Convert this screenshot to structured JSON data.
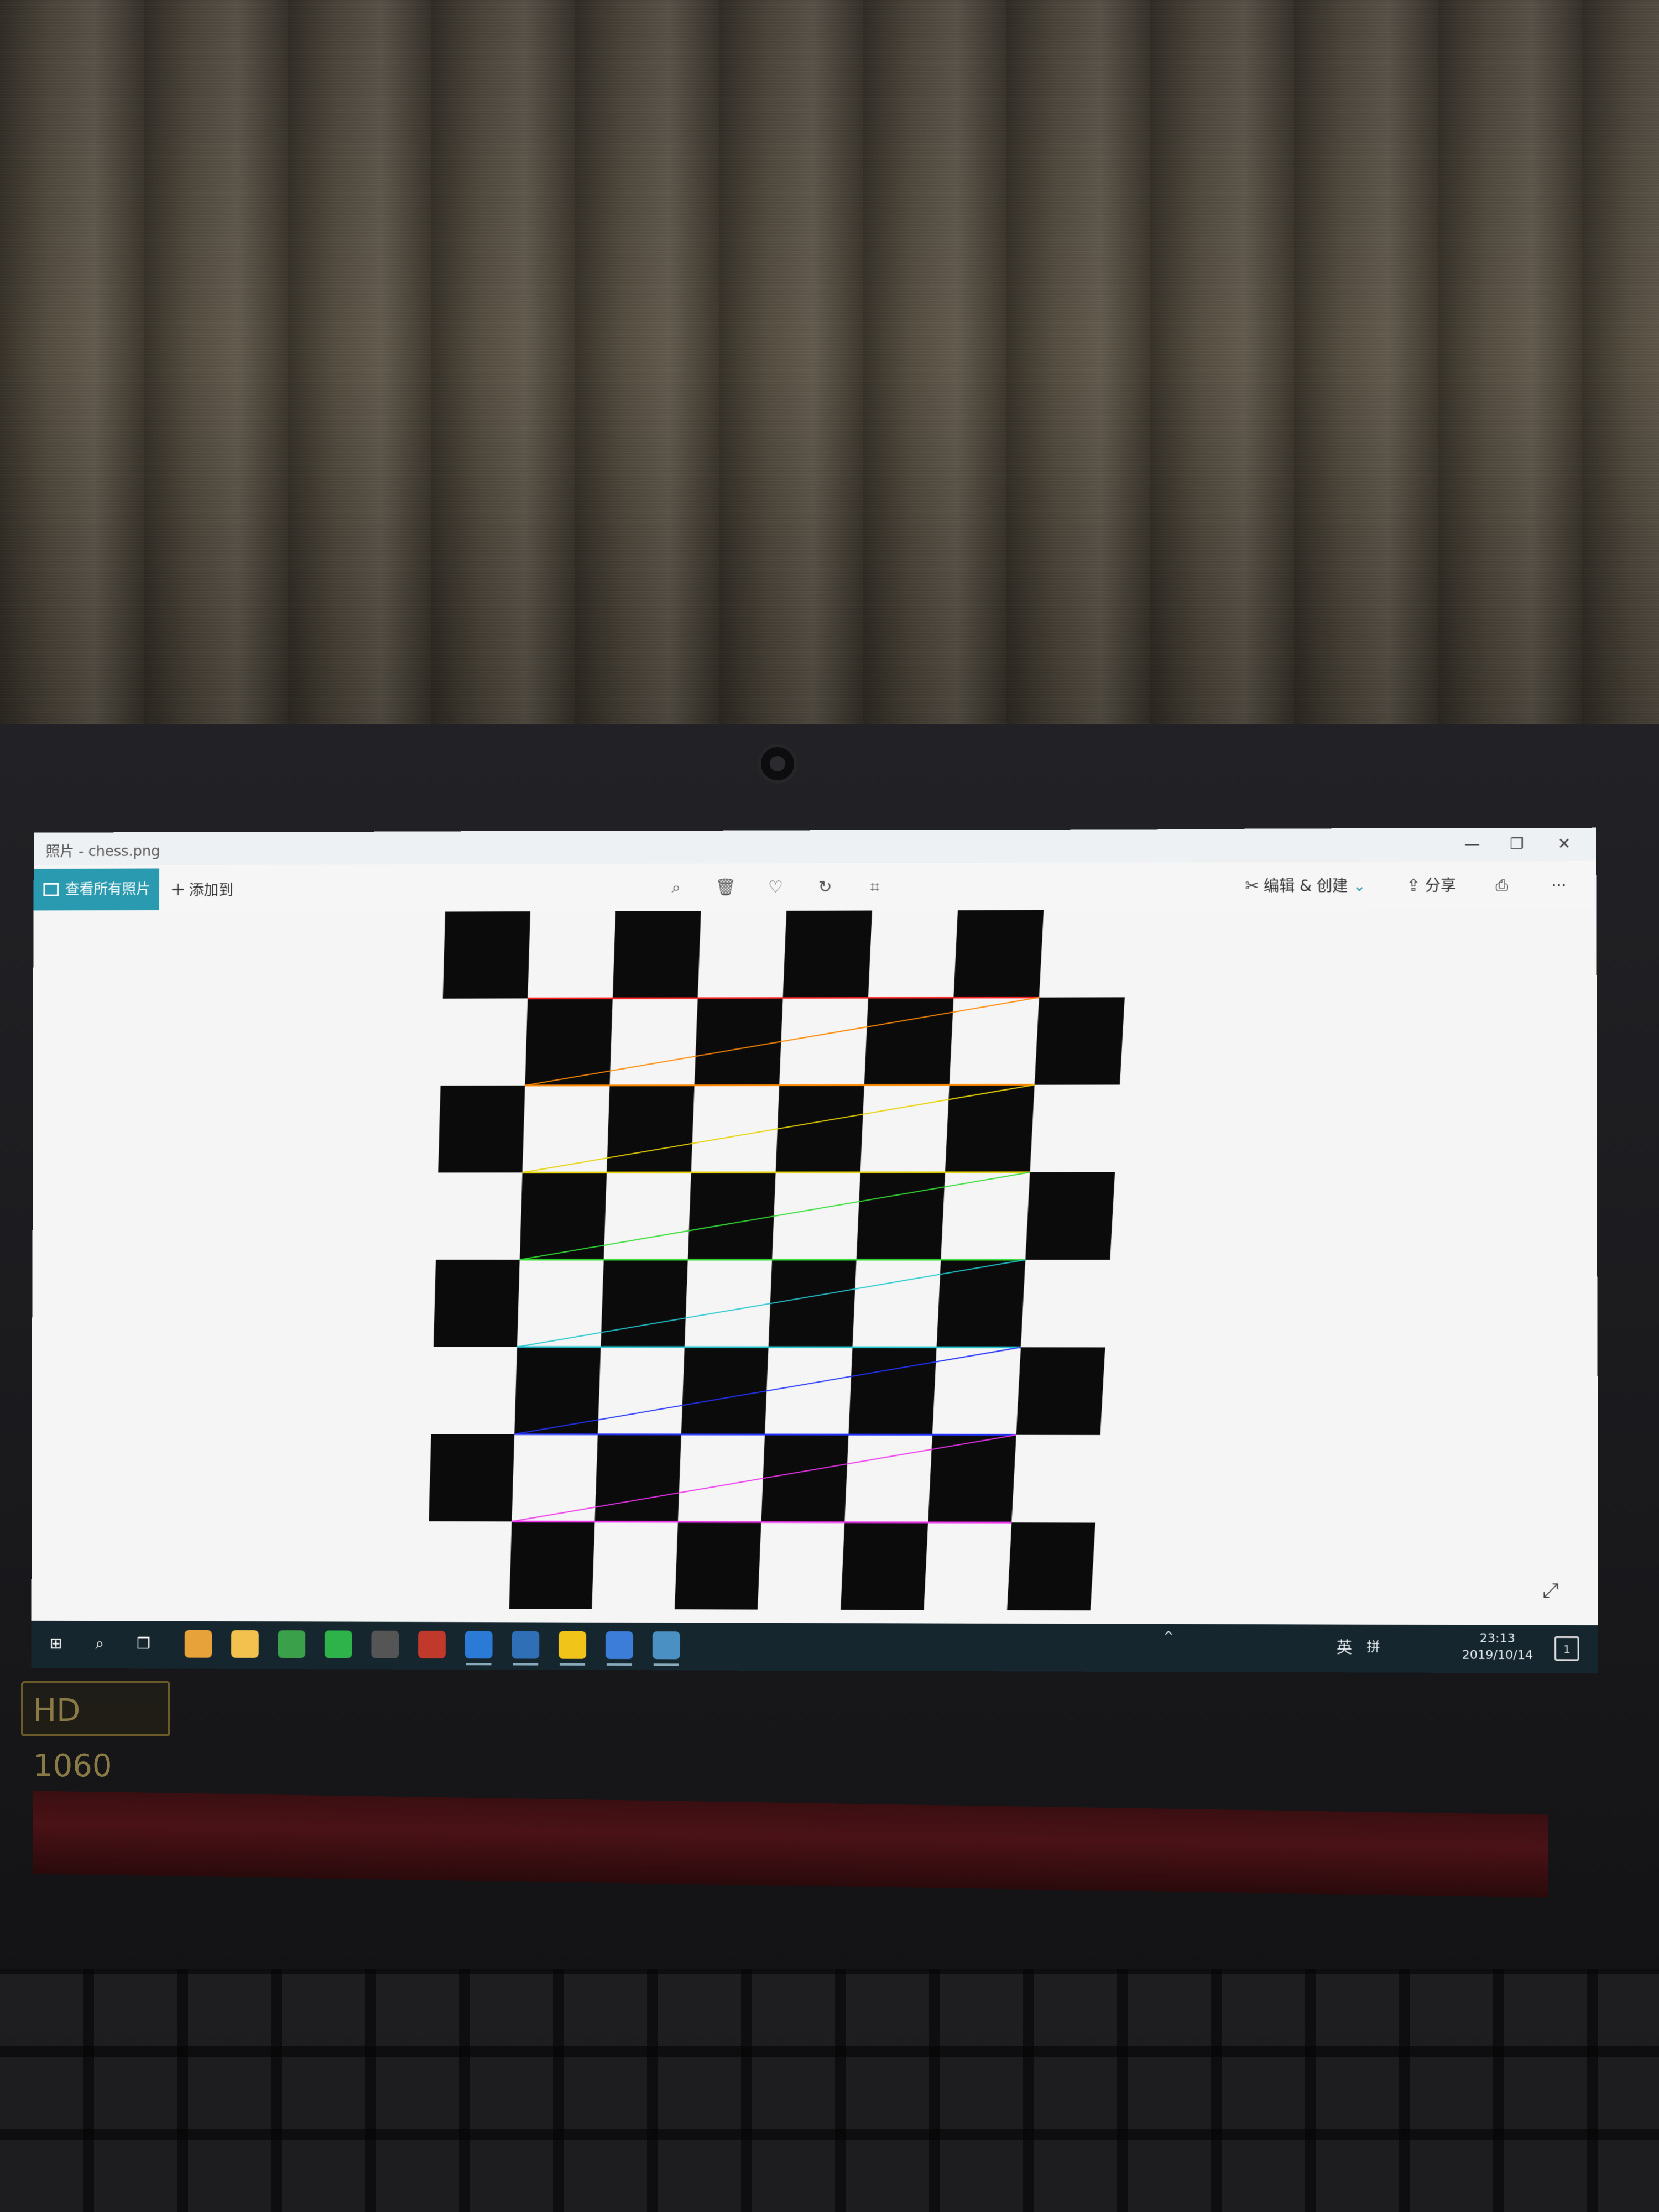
{
  "window": {
    "title": "照片 - chess.png",
    "minimize": "—",
    "restore": "❐",
    "close": "✕"
  },
  "toolbar": {
    "view_all": "查看所有照片",
    "add_to": "添加到",
    "add_plus": "+",
    "zoom_icon": "⌕",
    "delete_icon": "🗑",
    "favorite_icon": "♡",
    "rotate_icon": "↻",
    "crop_icon": "⌗",
    "edit_create": "编辑 & 创建",
    "edit_chevron": "⌄",
    "share": "分享",
    "share_icon": "⇪",
    "print_icon": "⎙",
    "more": "···"
  },
  "image": {
    "file": "chess.png",
    "type": "checkerboard",
    "corner_line_colors": [
      "#ff2020",
      "#ff8800",
      "#e8d200",
      "#33dd33",
      "#22c8d0",
      "#2233ff",
      "#ee33ee"
    ]
  },
  "viewer": {
    "expand_icon": "⤢"
  },
  "taskbar": {
    "start_icon": "⊞",
    "search_icon": "⌕",
    "taskview_icon": "❐",
    "apps": [
      "chrome-icon",
      "file-explorer-icon",
      "notes-icon",
      "refresh-app-icon",
      "n-app-icon",
      "power-app-icon",
      "teamviewer-icon",
      "vscode-icon",
      "python-icon",
      "reader-icon",
      "photos-icon"
    ],
    "tray_chevron": "^",
    "ime": "英",
    "ime_grid": "拼",
    "time": "23:13",
    "date": "2019/10/14",
    "notification_count": "1"
  },
  "device": {
    "sticker_hd": "HD 1060"
  }
}
